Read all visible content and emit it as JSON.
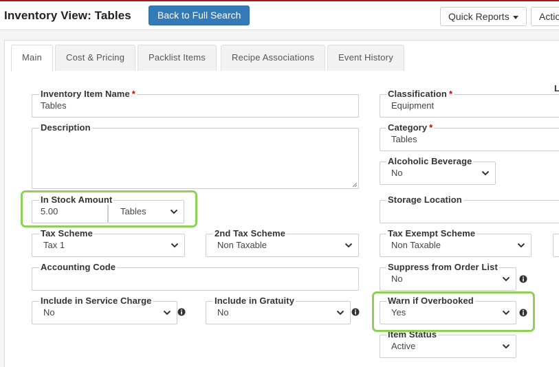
{
  "header": {
    "title": "Inventory View: Tables",
    "back_button": "Back to Full Search",
    "quick_reports": "Quick Reports",
    "actions": "Actio"
  },
  "tabs": [
    {
      "label": "Main",
      "active": true
    },
    {
      "label": "Cost & Pricing",
      "active": false
    },
    {
      "label": "Packlist Items",
      "active": false
    },
    {
      "label": "Recipe Associations",
      "active": false
    },
    {
      "label": "Event History",
      "active": false
    }
  ],
  "form": {
    "item_name": {
      "label": "Inventory Item Name",
      "required": "*",
      "value": "Tables"
    },
    "description": {
      "label": "Description",
      "value": ""
    },
    "in_stock": {
      "label": "In Stock Amount",
      "value": "5.00",
      "unit": "Tables"
    },
    "tax_scheme": {
      "label": "Tax Scheme",
      "value": "Tax 1"
    },
    "tax_scheme_2": {
      "label": "2nd Tax Scheme",
      "value": "Non Taxable"
    },
    "accounting_code": {
      "label": "Accounting Code",
      "value": ""
    },
    "service_charge": {
      "label": "Include in Service Charge",
      "value": "No"
    },
    "gratuity": {
      "label": "Include in Gratuity",
      "value": "No"
    },
    "classification": {
      "label": "Classification",
      "required": "*",
      "value": "Equipment"
    },
    "category": {
      "label": "Category",
      "required": "*",
      "value": "Tables"
    },
    "alcoholic": {
      "label": "Alcoholic Beverage",
      "value": "No"
    },
    "storage_location": {
      "label": "Storage Location",
      "value": ""
    },
    "tax_exempt": {
      "label": "Tax Exempt Scheme",
      "value": "Non Taxable"
    },
    "suppress": {
      "label": "Suppress from Order List",
      "value": "No"
    },
    "warn_overbooked": {
      "label": "Warn if Overbooked",
      "value": "Yes"
    },
    "item_status": {
      "label": "Item Status",
      "value": "Active"
    },
    "right_edge_label": "L"
  },
  "colors": {
    "primary": "#337ab7",
    "highlight": "#8ed155",
    "required": "#cc0000",
    "top_bar": "#9b1c1c"
  }
}
